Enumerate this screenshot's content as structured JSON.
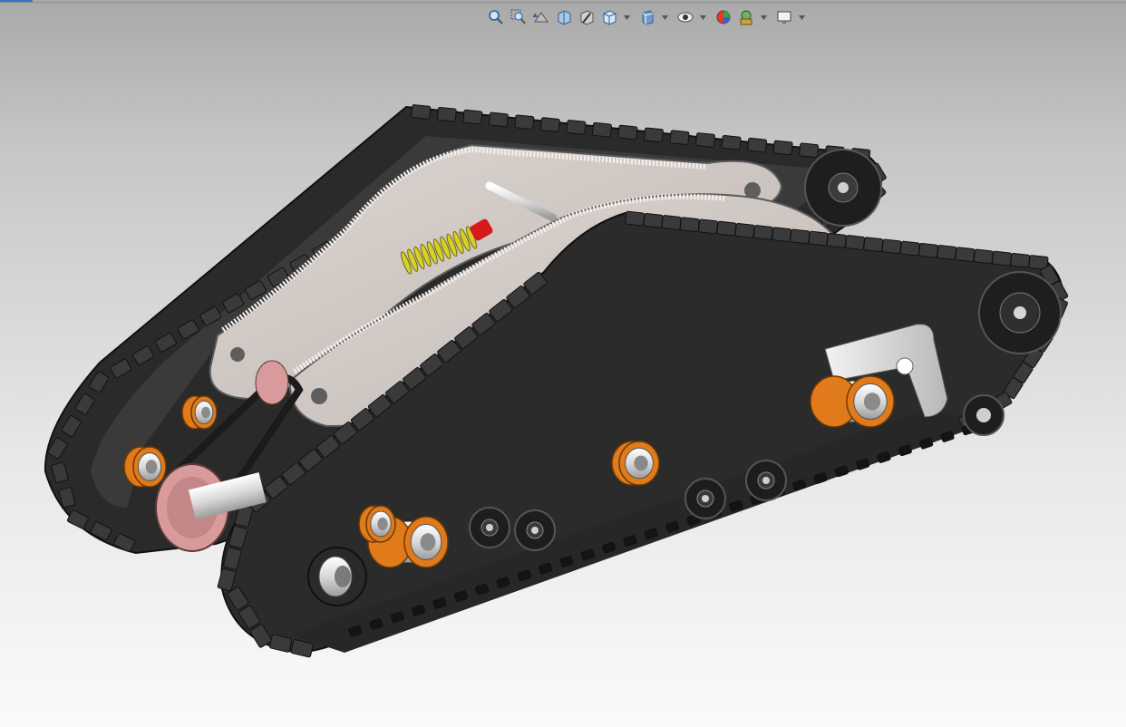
{
  "viewport": {
    "background_top": "#a9a9a9",
    "background_bottom": "#fafafa"
  },
  "heads_up_toolbar": {
    "items": [
      {
        "icon": "zoom-to-fit-icon",
        "has_dropdown": false
      },
      {
        "icon": "zoom-to-area-icon",
        "has_dropdown": false
      },
      {
        "icon": "previous-view-icon",
        "has_dropdown": false
      },
      {
        "icon": "section-view-icon",
        "has_dropdown": false
      },
      {
        "icon": "dynamic-annotation-views-icon",
        "has_dropdown": false
      },
      {
        "icon": "view-orientation-icon",
        "has_dropdown": true
      },
      {
        "icon": "display-style-icon",
        "has_dropdown": true
      },
      {
        "icon": "hide-show-items-icon",
        "has_dropdown": true
      },
      {
        "icon": "edit-appearance-icon",
        "has_dropdown": false
      },
      {
        "icon": "apply-scene-icon",
        "has_dropdown": true
      },
      {
        "icon": "view-settings-icon",
        "has_dropdown": true
      }
    ]
  },
  "model": {
    "name": "tracked-suspension-assembly",
    "colors": {
      "track": "#2b2b2b",
      "track_lug": "#3a3a3a",
      "side_plate": "#d4ccc8",
      "swing_arm": "#232323",
      "gearbox": "#c9a424",
      "spring": "#d8d02a",
      "shock_end": "#d41a1a",
      "bearing": "#e07a1a",
      "shaft": "#e6e6e6",
      "pulley": "#d89a9a",
      "belt": "#1b1b1b"
    }
  }
}
